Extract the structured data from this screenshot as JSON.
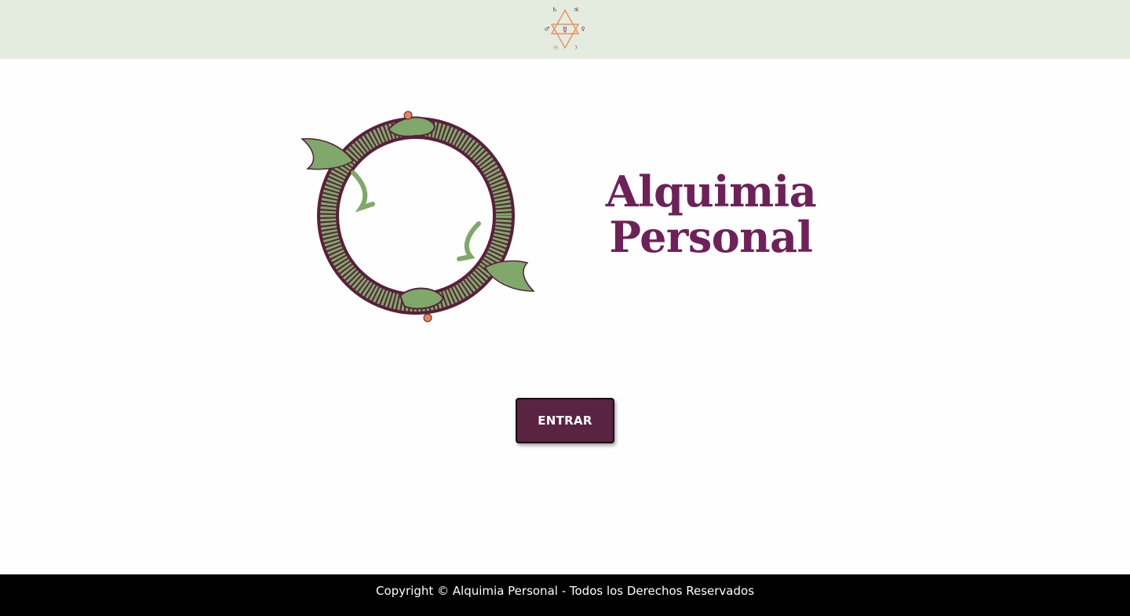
{
  "header": {
    "logo_icon": "alchemy-hexagram-icon"
  },
  "hero": {
    "image_icon": "ouroboros-dragon-icon",
    "title_line1": "Alquimia",
    "title_line2": "Personal"
  },
  "actions": {
    "enter_label": "ENTRAR"
  },
  "footer": {
    "copyright": "Copyright © Alquimia Personal - Todos los Derechos Reservados"
  },
  "colors": {
    "header_bg": "#e4ece0",
    "title": "#6e2158",
    "button_bg": "#5a2342",
    "footer_bg": "#000000",
    "dragon_green": "#7fa86a",
    "dragon_outline": "#5a1f3c",
    "accent_orange": "#e8845a"
  }
}
